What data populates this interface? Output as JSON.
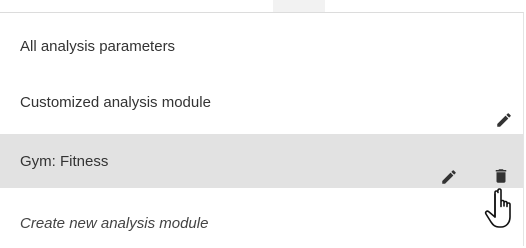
{
  "menu": {
    "items": [
      {
        "label": "All analysis parameters"
      },
      {
        "label": "Customized analysis module",
        "actions": [
          "pencil-icon"
        ]
      },
      {
        "label": "Gym: Fitness",
        "actions": [
          "pencil-icon",
          "trash-icon"
        ],
        "state": "hovered"
      },
      {
        "label": "Create new analysis module",
        "style": "italic"
      }
    ]
  },
  "colors": {
    "hover_background": "#e2e2e2",
    "text": "#333333",
    "icon": "#333333"
  }
}
